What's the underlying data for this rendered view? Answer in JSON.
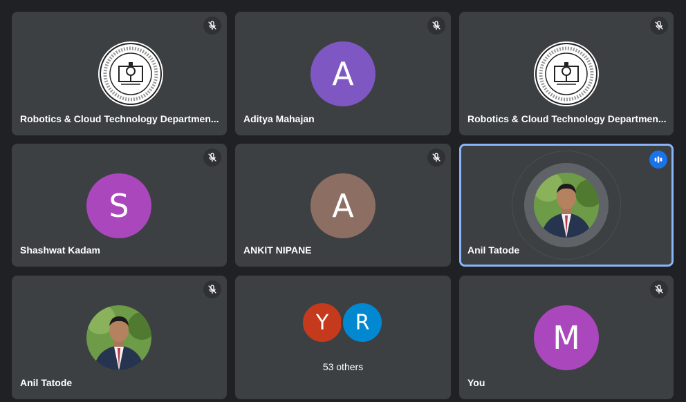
{
  "tiles": [
    {
      "name": "Robotics & Cloud Technology Departmen...",
      "type": "seal",
      "muted": true
    },
    {
      "name": "Aditya Mahajan",
      "type": "letter",
      "initial": "A",
      "color": "#7e57c2",
      "muted": true
    },
    {
      "name": "Robotics & Cloud Technology Departmen...",
      "type": "seal",
      "muted": true
    },
    {
      "name": "Shashwat Kadam",
      "type": "letter",
      "initial": "S",
      "color": "#ab47bc",
      "muted": true
    },
    {
      "name": "ANKIT NIPANE",
      "type": "letter",
      "initial": "A",
      "color": "#8d6e63",
      "muted": true
    },
    {
      "name": "Anil Tatode",
      "type": "photo",
      "muted": false,
      "speaking": true
    },
    {
      "name": "Anil Tatode",
      "type": "photo",
      "muted": true
    },
    {
      "type": "others",
      "others_label": "53 others",
      "avatars": [
        {
          "initial": "Y",
          "color": "#c5391d"
        },
        {
          "initial": "R",
          "color": "#0288d1"
        }
      ]
    },
    {
      "name": "You",
      "type": "letter",
      "initial": "M",
      "color": "#ab47bc",
      "muted": true
    }
  ],
  "icons": {
    "muted": "mic-off-icon",
    "speaking": "audio-levels-icon"
  },
  "colors": {
    "background": "#202124",
    "tile": "#3c4043",
    "speaking_border": "#8ab4f8",
    "speaking_badge": "#1a73e8"
  }
}
